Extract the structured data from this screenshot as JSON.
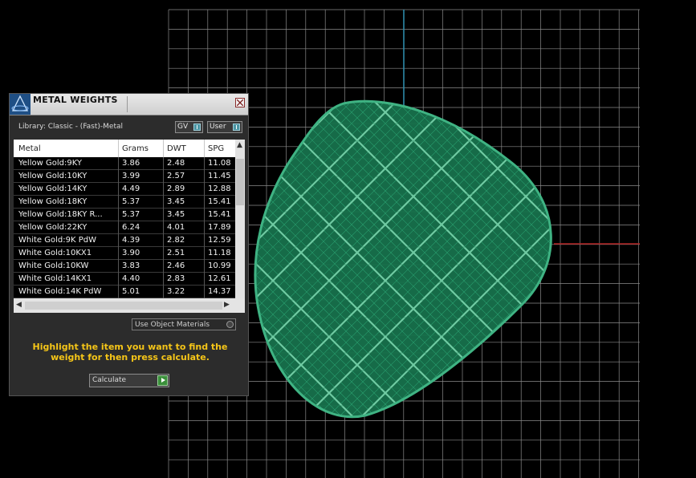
{
  "viewport": {
    "grid_color": "#8a8a8a",
    "axis_y_color": "#2d8fb0",
    "axis_x_color": "#b02020",
    "mesh_color": "#1f8a5e"
  },
  "panel": {
    "title": "METAL WEIGHTS",
    "library_label": "Library: Classic - (Fast)-Metal",
    "gv_label": "GV",
    "user_label": "User",
    "columns": [
      "Metal",
      "Grams",
      "DWT",
      "SPG"
    ],
    "rows": [
      {
        "metal": "Yellow Gold:9KY",
        "grams": "3.86",
        "dwt": "2.48",
        "spg": "11.08"
      },
      {
        "metal": "Yellow Gold:10KY",
        "grams": "3.99",
        "dwt": "2.57",
        "spg": "11.45"
      },
      {
        "metal": "Yellow Gold:14KY",
        "grams": "4.49",
        "dwt": "2.89",
        "spg": "12.88"
      },
      {
        "metal": "Yellow Gold:18KY",
        "grams": "5.37",
        "dwt": "3.45",
        "spg": "15.41"
      },
      {
        "metal": "Yellow Gold:18KY R...",
        "grams": "5.37",
        "dwt": "3.45",
        "spg": "15.41"
      },
      {
        "metal": "Yellow Gold:22KY",
        "grams": "6.24",
        "dwt": "4.01",
        "spg": "17.89"
      },
      {
        "metal": "White Gold:9K PdW",
        "grams": "4.39",
        "dwt": "2.82",
        "spg": "12.59"
      },
      {
        "metal": "White Gold:10KX1",
        "grams": "3.90",
        "dwt": "2.51",
        "spg": "11.18"
      },
      {
        "metal": "White Gold:10KW",
        "grams": "3.83",
        "dwt": "2.46",
        "spg": "10.99"
      },
      {
        "metal": "White Gold:14KX1",
        "grams": "4.40",
        "dwt": "2.83",
        "spg": "12.61"
      },
      {
        "metal": "White Gold:14K PdW",
        "grams": "5.01",
        "dwt": "3.22",
        "spg": "14.37"
      }
    ],
    "use_object_materials": "Use Object Materials",
    "instructions": "Highlight the item you want to find the weight for then press calculate.",
    "calculate_label": "Calculate"
  }
}
